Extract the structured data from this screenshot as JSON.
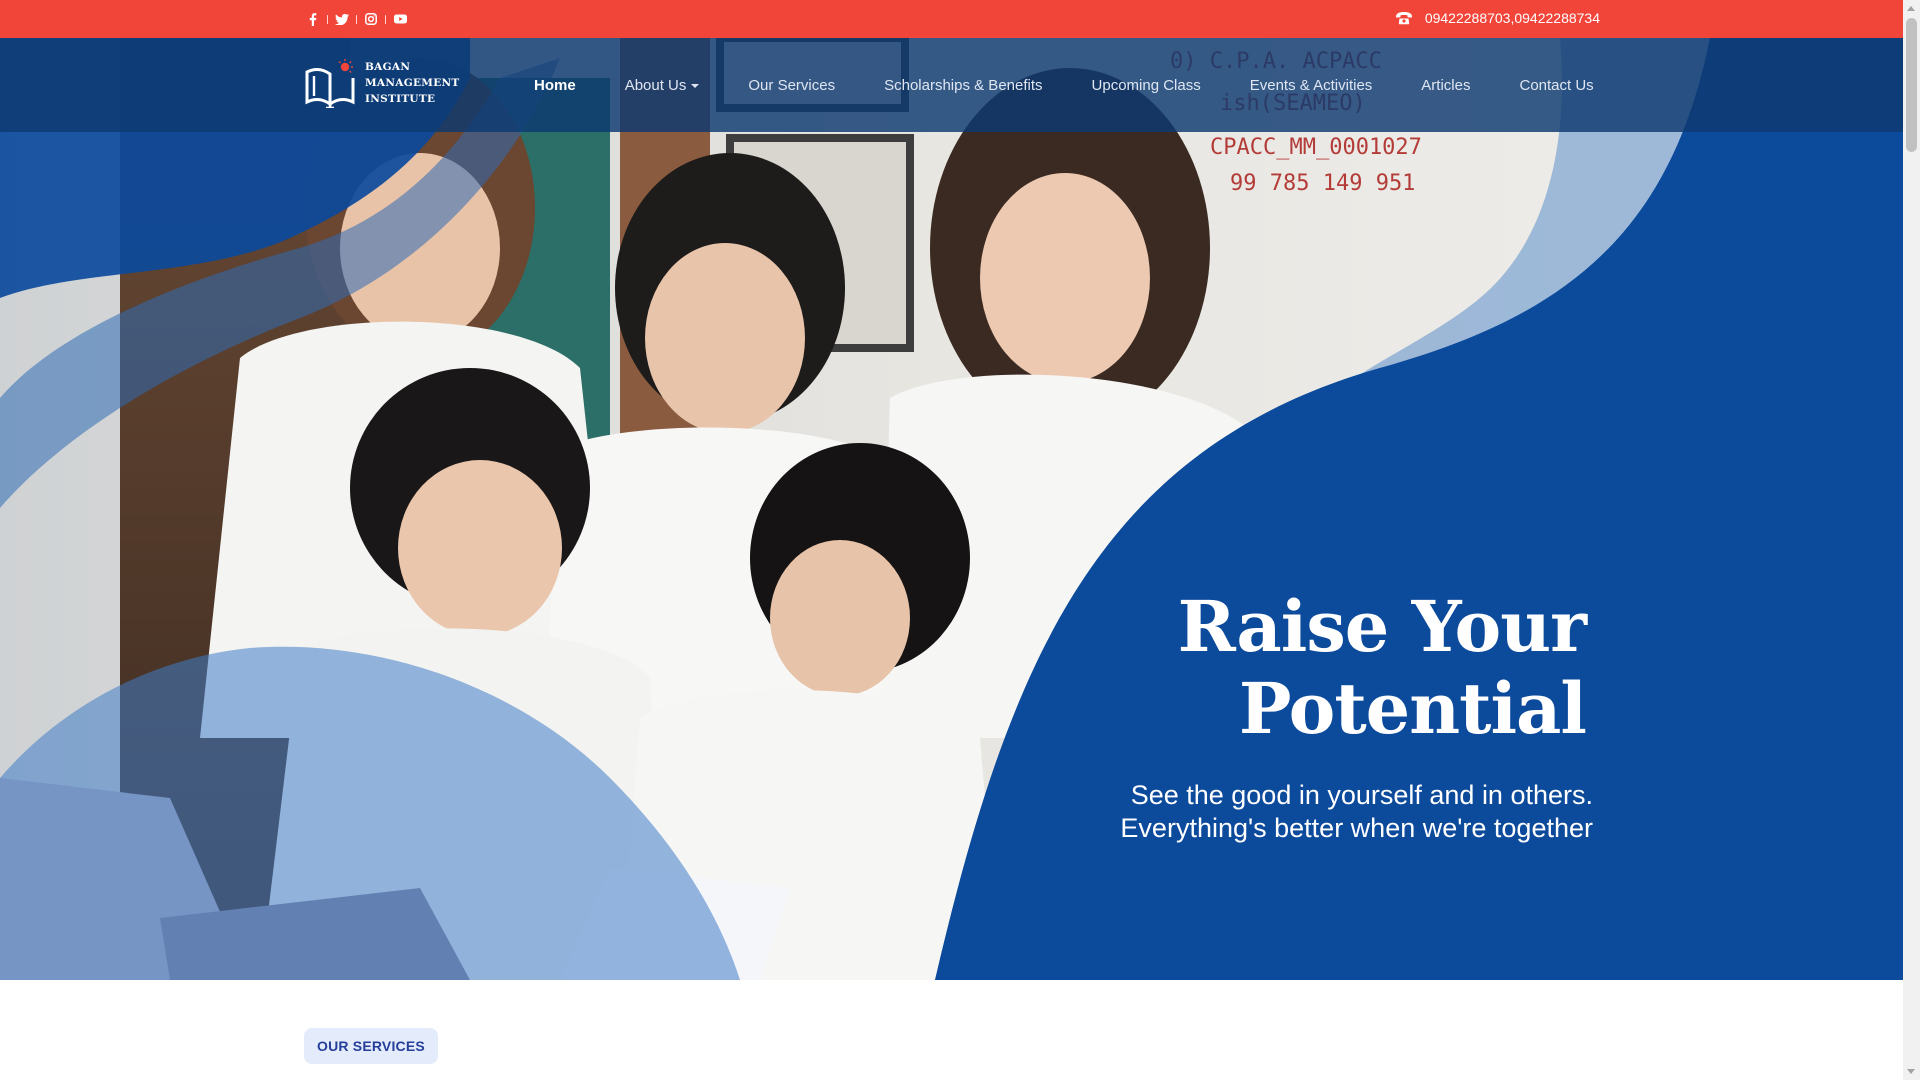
{
  "topbar": {
    "social": [
      {
        "icon": "facebook-icon"
      },
      {
        "icon": "twitter-icon"
      },
      {
        "icon": "instagram-icon"
      },
      {
        "icon": "youtube-icon"
      }
    ],
    "phone": "09422288703,09422288734"
  },
  "logo": {
    "line1": "BAGAN",
    "line2": "MANAGEMENT",
    "line3": "INSTITUTE"
  },
  "nav": {
    "items": [
      {
        "label": "Home",
        "active": true
      },
      {
        "label": "About Us",
        "dropdown": true
      },
      {
        "label": "Our Services"
      },
      {
        "label": "Scholarships & Benefits"
      },
      {
        "label": "Upcoming Class"
      },
      {
        "label": "Events & Activities"
      },
      {
        "label": "Articles"
      },
      {
        "label": "Contact Us"
      }
    ]
  },
  "hero": {
    "headline_line1": "Raise Your",
    "headline_line2": "Potential",
    "sub_line1": "See the good in yourself and in others.",
    "sub_line2": "Everything's better when we're together"
  },
  "section": {
    "badge": "OUR SERVICES"
  },
  "colors": {
    "topbar": "#f2453a",
    "nav": "#0d3970",
    "hero_blue": "#0c4a9c",
    "badge_bg": "#e4ebfa",
    "badge_text": "#243f9a"
  }
}
